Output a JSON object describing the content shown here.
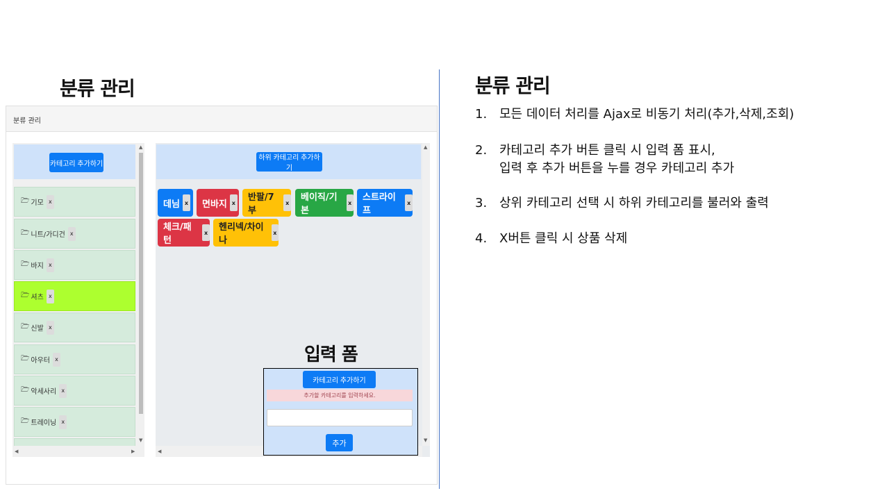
{
  "titles": {
    "left": "분류 관리",
    "right": "분류 관리",
    "form": "입력 폼"
  },
  "panel": {
    "header": "분류 관리"
  },
  "category_list": {
    "add_button": "카테고리 추가하기",
    "items": [
      {
        "label": "기모",
        "x": "x"
      },
      {
        "label": "니트/가디건",
        "x": "x"
      },
      {
        "label": "바지",
        "x": "x"
      },
      {
        "label": "셔츠",
        "x": "x",
        "active": true
      },
      {
        "label": "신발",
        "x": "x"
      },
      {
        "label": "아우터",
        "x": "x"
      },
      {
        "label": "악세사리",
        "x": "x"
      },
      {
        "label": "트레이닝",
        "x": "x"
      }
    ]
  },
  "subcategory": {
    "add_button": "하위 카테고리 추가하기",
    "tags": [
      {
        "label": "데님",
        "color": "blue"
      },
      {
        "label": "면바지",
        "color": "red"
      },
      {
        "label": "반팔/7부",
        "color": "yellow"
      },
      {
        "label": "베이직/기본",
        "color": "green"
      },
      {
        "label": "스트라이프",
        "color": "blue"
      },
      {
        "label": "체크/패턴",
        "color": "red"
      },
      {
        "label": "헨리넥/차이나",
        "color": "yellow"
      }
    ],
    "x_label": "x"
  },
  "form": {
    "title_button": "카테고리 추가하기",
    "alert": "추가할 카테고리를 입력하세요.",
    "input_value": "",
    "submit": "추가"
  },
  "notes": [
    {
      "num": "1.",
      "text": "모든 데이터 처리를 Ajax로 비동기 처리(추가,삭제,조회)"
    },
    {
      "num": "2.",
      "text": "카테고리 추가 버튼 클릭 시 입력 폼 표시,"
    },
    {
      "num": "",
      "text": "입력 후 추가 버튼을 누를 경우 카테고리 추가"
    },
    {
      "num": "3.",
      "text": "상위 카테고리 선택 시 하위 카테고리를 불러와 출력"
    },
    {
      "num": "4.",
      "text": "X버튼 클릭 시 상품 삭제"
    }
  ],
  "colors": {
    "accent": "#0d7bf5",
    "active_item": "#adff2f",
    "divider": "#4472c4"
  }
}
